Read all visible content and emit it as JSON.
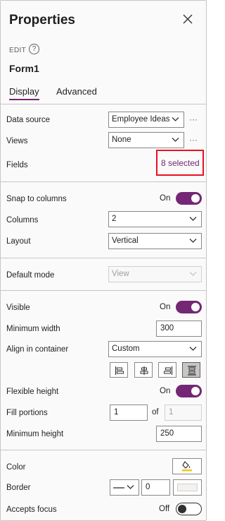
{
  "header": {
    "title": "Properties",
    "edit_label": "EDIT",
    "help_glyph": "?",
    "form_name": "Form1"
  },
  "tabs": [
    {
      "label": "Display",
      "selected": true
    },
    {
      "label": "Advanced",
      "selected": false
    }
  ],
  "data_section": {
    "data_source": {
      "label": "Data source",
      "value": "Employee Ideas",
      "more": "···"
    },
    "views": {
      "label": "Views",
      "value": "None",
      "more": "···"
    },
    "fields": {
      "label": "Fields",
      "link": "8 selected"
    }
  },
  "layout_section": {
    "snap": {
      "label": "Snap to columns",
      "state": "On"
    },
    "columns": {
      "label": "Columns",
      "value": "2"
    },
    "layout": {
      "label": "Layout",
      "value": "Vertical"
    }
  },
  "mode_section": {
    "default_mode": {
      "label": "Default mode",
      "value": "View"
    }
  },
  "container_section": {
    "visible": {
      "label": "Visible",
      "state": "On"
    },
    "min_width": {
      "label": "Minimum width",
      "value": "300"
    },
    "align": {
      "label": "Align in container",
      "value": "Custom",
      "options_selected": "stretch"
    },
    "flexible_height": {
      "label": "Flexible height",
      "state": "On"
    },
    "fill_portions": {
      "label": "Fill portions",
      "value": "1",
      "of_label": "of",
      "of_value": "1"
    },
    "min_height": {
      "label": "Minimum height",
      "value": "250"
    }
  },
  "style_section": {
    "color": {
      "label": "Color"
    },
    "border": {
      "label": "Border",
      "width": "0"
    },
    "accepts_focus": {
      "label": "Accepts focus",
      "state": "Off"
    }
  },
  "colors": {
    "accent": "#742774",
    "highlight_box": "#e81123",
    "divider": "#c8c6c4"
  }
}
